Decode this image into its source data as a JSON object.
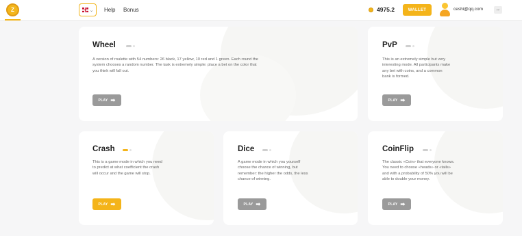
{
  "header": {
    "logo_text": "Z",
    "language": "en",
    "nav": {
      "help": "Help",
      "bonus": "Bonus"
    },
    "balance": "4975.2",
    "wallet_label": "WALLET",
    "email": "ceshi@qq.com",
    "exit_label": "↦"
  },
  "colors": {
    "accent": "#f4b41a",
    "play_inactive": "#9a9a9a"
  },
  "games": {
    "wheel": {
      "title": "Wheel",
      "description": "A version of roulette with 54 numbers: 26 black, 17 yellow, 10 red and 1 green. Each round the system chooses a random number. The task is extremely simple: place a bet on the color that you think will fall out.",
      "play": "PLAY"
    },
    "pvp": {
      "title": "PvP",
      "description": "This is an extremely simple but very interesting mode. All participants make any bet with coins, and a common bank is formed.",
      "play": "PLAY"
    },
    "crash": {
      "title": "Crash",
      "description": "This is a game mode in which you need to predict at what coefficient the crash will occur and the game will stop.",
      "play": "PLAY"
    },
    "dice": {
      "title": "Dice",
      "description": "A game mode in which you yourself choose the chance of winning, but remember: the higher the odds, the less chance of winning.",
      "play": "PLAY"
    },
    "coinflip": {
      "title": "CoinFlip",
      "description": "The classic «Coin» that everyone knows. You need to choose «heads» or «tails» and with a probability of 50% you will be able to double your money.",
      "play": "PLAY"
    }
  }
}
